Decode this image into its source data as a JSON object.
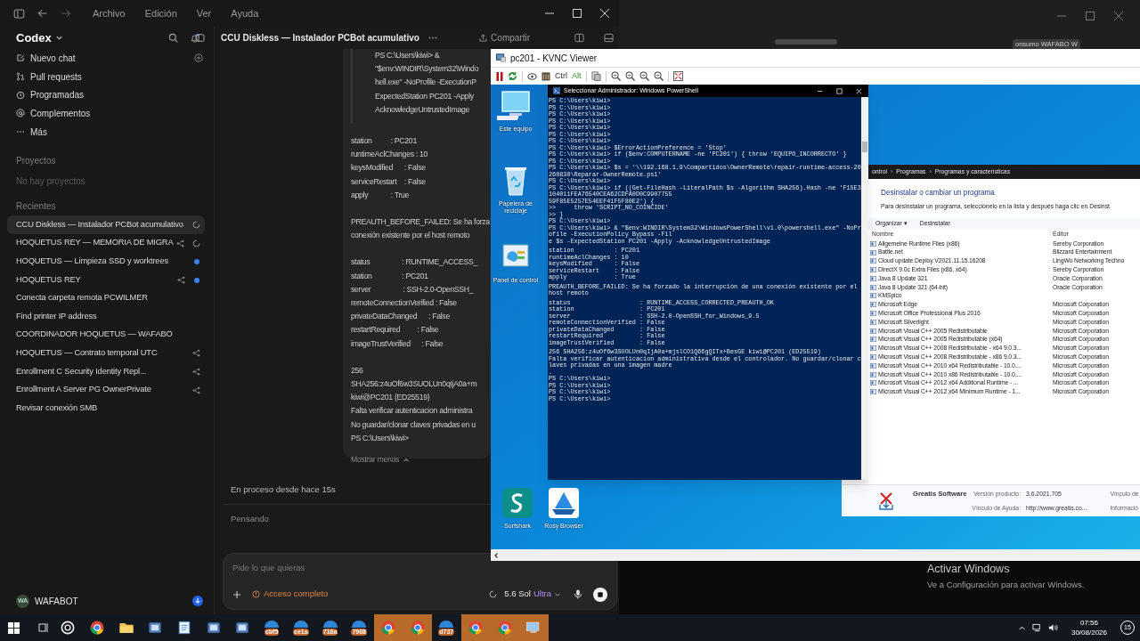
{
  "codex": {
    "menu": [
      "Archivo",
      "Edición",
      "Ver",
      "Ayuda"
    ],
    "app_name": "Codex",
    "nav": [
      {
        "label": "Nuevo chat"
      },
      {
        "label": "Pull requests"
      },
      {
        "label": "Programadas"
      },
      {
        "label": "Complementos"
      },
      {
        "label": "Más"
      }
    ],
    "projects_heading": "Proyectos",
    "projects_empty": "No hay proyectos",
    "recents_heading": "Recientes",
    "recents": [
      {
        "label": "CCU Diskless — Instalador PCBot acumulativo",
        "selected": true,
        "shared": false,
        "running": true,
        "unread": false
      },
      {
        "label": "HOQUETUS REY — MEMORIA DE MIGRA",
        "selected": false,
        "shared": true,
        "running": true,
        "unread": false
      },
      {
        "label": "HOQUETUS — Limpieza SSD y worktrees",
        "selected": false,
        "shared": false,
        "running": false,
        "unread": true
      },
      {
        "label": "HOQUETUS REY",
        "selected": false,
        "shared": true,
        "running": false,
        "unread": true
      },
      {
        "label": "Conecta carpeta remota PCWILMER",
        "selected": false,
        "shared": false,
        "running": false,
        "unread": false
      },
      {
        "label": "Find printer IP address",
        "selected": false,
        "shared": false,
        "running": false,
        "unread": false
      },
      {
        "label": "COORDINADOR HOQUETUS — WAFABO",
        "selected": false,
        "shared": false,
        "running": false,
        "unread": false
      },
      {
        "label": "HOQUETUS — Contrato temporal UTC",
        "selected": false,
        "shared": true,
        "running": false,
        "unread": false
      },
      {
        "label": "Enrollment C Security Identity Repl...",
        "selected": false,
        "shared": true,
        "running": false,
        "unread": false
      },
      {
        "label": "Enrollment A Server PG OwnerPrivate",
        "selected": false,
        "shared": true,
        "running": false,
        "unread": false
      },
      {
        "label": "Revisar conexión SMB",
        "selected": false,
        "shared": false,
        "running": false,
        "unread": false
      }
    ],
    "user": {
      "initials": "WA",
      "name": "WAFABOT"
    },
    "thread_title": "CCU Diskless — Instalador PCBot acumulativo",
    "share": "Compartir",
    "message": {
      "quote": [
        "PS C:\\Users\\kiwi> &",
        "\"$env:WINDIR\\System32\\Windo",
        "hell.exe\" -NoProfile -ExecutionP",
        "ExpectedStation PC201 -Apply",
        "AcknowledgeUntrustedImage"
      ],
      "blocks": [
        [
          "station          : PC201",
          "runtimeAclChanges : 10",
          "keysModified      : False",
          "serviceRestart    : False",
          "apply            : True"
        ],
        [
          "PREAUTH_BEFORE_FAILED: Se ha forza",
          "conexión existente por el host remoto"
        ],
        [
          "status                 : RUNTIME_ACCESS_",
          "station                : PC201",
          "server                 : SSH-2.0-OpenSSH_",
          "remoteConnectionVerified : False",
          "privateDataChanged      : False",
          "restartRequired         : False",
          "imageTrustVerified      : False"
        ],
        [
          "256",
          "SHA256:z4uOf6w3SUOLUn0qIjA0a+m",
          "kiwi@PC201 (ED25519)",
          "Falta verificar autenticacion administra",
          "No guardar/clonar claves privadas en u",
          "PS C:\\Users\\kiwi>"
        ]
      ],
      "toggle": "Mostrar menos"
    },
    "status": "En proceso desde hace 15s",
    "thinking": "Pensando",
    "composer": {
      "placeholder": "Pide lo que quieras",
      "access": "Acceso completo",
      "model": "5.6 Sol",
      "effort": "Ultra"
    }
  },
  "back_window": {
    "tab": "onsumo WAFABO W"
  },
  "vnc": {
    "title": "pc201 - KVNC Viewer",
    "keys": [
      "Ctrl",
      "Alt"
    ],
    "desktop_icons": [
      {
        "label": "Este equipo"
      },
      {
        "label": "Papelera de reciclaje"
      },
      {
        "label": "Panel de control"
      },
      {
        "label": "Surfshark"
      },
      {
        "label": "Rosy Browser"
      }
    ],
    "powershell": {
      "title": "Seleccionar Administrador: Windows PowerShell",
      "blocks": [
        [
          "PS C:\\Users\\kiwi>",
          "PS C:\\Users\\kiwi>",
          "PS C:\\Users\\kiwi>",
          "PS C:\\Users\\kiwi>",
          "PS C:\\Users\\kiwi>",
          "PS C:\\Users\\kiwi>",
          "PS C:\\Users\\kiwi>",
          "PS C:\\Users\\kiwi> $ErrorActionPreference = 'Stop'",
          "PS C:\\Users\\kiwi> if ($env:COMPUTERNAME -ne 'PC201') { throw 'EQUIPO_INCORRECTO' }",
          "PS C:\\Users\\kiwi>",
          "PS C:\\Users\\kiwi> $s = '\\\\192.168.1.9\\Compartidos\\OwnerRemote\\repair-runtime-access-20260830\\Reparar-OwnerRemote.ps1'",
          "PS C:\\Users\\kiwi>",
          "PS C:\\Users\\kiwi> if ((Get-FileHash -LiteralPath $s -Algorithm SHA256).Hash -ne 'F15E3104011FEA76540CEA62CDFA0D0C9907755",
          "59F85E5257E54EEF41F5F80E2') {",
          ">>     throw 'SCRIPT_NO_COINCIDE'",
          ">> }",
          "PS C:\\Users\\kiwi>",
          "PS C:\\Users\\kiwi> & \"$env:WINDIR\\System32\\WindowsPowerShell\\v1.0\\powershell.exe\" -NoProfile -ExecutionPolicy Bypass -Fil",
          "e $s -ExpectedStation PC201 -Apply -AcknowledgeUntrustedImage"
        ],
        [
          "station           : PC201",
          "runtimeAclChanges : 10",
          "keysModified      : False",
          "serviceRestart    : False",
          "apply             : True"
        ],
        [
          "PREAUTH_BEFORE_FAILED: Se ha forzado la interrupción de una conexión existente por el host remoto"
        ],
        [
          "status                   : RUNTIME_ACCESS_CORRECTED_PREAUTH_OK",
          "station                  : PC201",
          "server                   : SSH-2.0-OpenSSH_for_Windows_9.5",
          "remoteConnectionVerified : False",
          "privateDataChanged       : False",
          "restartRequired          : False",
          "imageTrustVerified       : False"
        ],
        [
          "256 SHA256:z4uOf6w3SUOLUn0qIjA0a+mjslCO1Q66gQITx+BesGE kiwi@PC201 (ED25519)",
          "Falta verificar autenticacion administrativa desde el controlador. No guardar/clonar claves privadas en una imagen madre",
          ".",
          "PS C:\\Users\\kiwi>",
          "PS C:\\Users\\kiwi>",
          "PS C:\\Users\\kiwi>",
          "PS C:\\Users\\kiwi>"
        ]
      ]
    },
    "control_panel": {
      "breadcrumb": [
        "ontrol",
        "Programas",
        "Programas y características"
      ],
      "separator": "›",
      "title": "Desinstalar o cambiar un programa",
      "description": "Para desinstalar un programa, selecciónelo en la lista y después haga clic en Desinst",
      "toolbar": [
        "Organizar ▾",
        "Desinstalar"
      ],
      "columns": [
        "Nombre",
        "Editor"
      ],
      "rows": [
        {
          "name": "Allgemeine Runtime Files (x86)",
          "editor": "Sereby Corporation"
        },
        {
          "name": "Battle.net",
          "editor": "Blizzard Entertainment"
        },
        {
          "name": "Cloud update Deploy V2021.11.15.16208",
          "editor": "LingWo Networking Techno"
        },
        {
          "name": "DirectX 9.0c Extra Files (x86, x64)",
          "editor": "Sereby Corporation"
        },
        {
          "name": "Java 8 Update 321",
          "editor": "Oracle Corporation"
        },
        {
          "name": "Java 8 Update 321 (64-bit)",
          "editor": "Oracle Corporation"
        },
        {
          "name": "KMSpico"
        },
        {
          "name": "Microsoft Edge",
          "editor": "Microsoft Corporation"
        },
        {
          "name": "Microsoft Office Professional Plus 2016",
          "editor": "Microsoft Corporation"
        },
        {
          "name": "Microsoft Silverlight",
          "editor": "Microsoft Corporation"
        },
        {
          "name": "Microsoft Visual C++ 2005 Redistributable",
          "editor": "Microsoft Corporation"
        },
        {
          "name": "Microsoft Visual C++ 2005 Redistributable (x64)",
          "editor": "Microsoft Corporation"
        },
        {
          "name": "Microsoft Visual C++ 2008 Redistributable - x64 9.0.3...",
          "editor": "Microsoft Corporation"
        },
        {
          "name": "Microsoft Visual C++ 2008 Redistributable - x86 9.0.3...",
          "editor": "Microsoft Corporation"
        },
        {
          "name": "Microsoft Visual C++ 2010  x64 Redistributable - 10.0....",
          "editor": "Microsoft Corporation"
        },
        {
          "name": "Microsoft Visual C++ 2010  x86 Redistributable - 10.0....",
          "editor": "Microsoft Corporation"
        },
        {
          "name": "Microsoft Visual C++ 2012 x64 Additional Runtime - ...",
          "editor": "Microsoft Corporation"
        },
        {
          "name": "Microsoft Visual C++ 2012 x64 Minimum Runtime - 1...",
          "editor": "Microsoft Corporation"
        }
      ],
      "details": {
        "publisher": "Greatis Software",
        "version_label": "Versión producto:",
        "version": "3.6.2021.705",
        "link_label": "Vínculo de",
        "help_label": "Vínculo de Ayuda:",
        "help_url": "http://www.greatis.co...",
        "info_label": "Informació"
      }
    }
  },
  "activation": {
    "title": "Activar Windows",
    "hint": "Ve a Configuración para activar Windows."
  },
  "taskbar": {
    "apps": [
      {
        "kind": "chatgpt",
        "highlighted": false
      },
      {
        "kind": "chrome",
        "highlighted": false
      },
      {
        "kind": "folder",
        "highlighted": false
      },
      {
        "kind": "app",
        "highlighted": false
      },
      {
        "kind": "notepad",
        "highlighted": false
      },
      {
        "kind": "app",
        "highlighted": false
      },
      {
        "kind": "app",
        "highlighted": false
      },
      {
        "kind": "labelled",
        "label": "cbf5",
        "highlighted": false
      },
      {
        "kind": "labelled",
        "label": "ce1a",
        "highlighted": false
      },
      {
        "kind": "labelled",
        "label": "716a",
        "highlighted": false
      },
      {
        "kind": "labelled",
        "label": "7968",
        "highlighted": false
      },
      {
        "kind": "chrome",
        "highlighted": true
      },
      {
        "kind": "chrome",
        "highlighted": true
      },
      {
        "kind": "labelled",
        "label": "d737",
        "highlighted": false
      },
      {
        "kind": "chrome",
        "highlighted": true
      },
      {
        "kind": "chrome",
        "highlighted": true
      },
      {
        "kind": "remote",
        "highlighted": true
      }
    ],
    "time": "07:56",
    "date": "30/08/2026",
    "notifications": "15"
  }
}
